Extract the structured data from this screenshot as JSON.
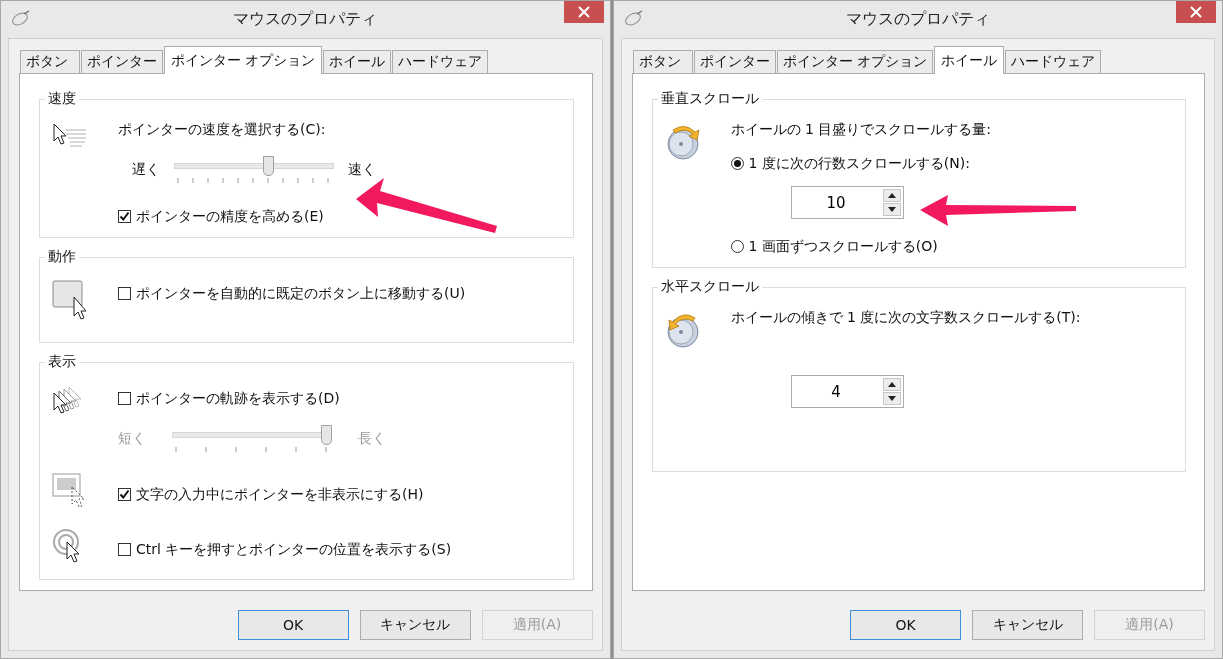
{
  "windows": [
    {
      "title": "マウスのプロパティ",
      "tabs": [
        {
          "label": "ボタン",
          "selected": false
        },
        {
          "label": "ポインター",
          "selected": false
        },
        {
          "label": "ポインター オプション",
          "selected": true
        },
        {
          "label": "ホイール",
          "selected": false
        },
        {
          "label": "ハードウェア",
          "selected": false
        }
      ],
      "groups": [
        {
          "title": "速度",
          "sections": [
            {
              "kind": "speed",
              "rows": [
                {
                  "kind": "label",
                  "text": "ポインターの速度を選択する(C):"
                },
                {
                  "kind": "slider",
                  "left": "遅く",
                  "right": "速く",
                  "level": 0.6,
                  "disabled": false
                },
                {
                  "kind": "checkbox",
                  "label": "ポインターの精度を高める(E)",
                  "checked": true
                }
              ]
            }
          ]
        },
        {
          "title": "動作",
          "sections": [
            {
              "kind": "snap",
              "rows": [
                {
                  "kind": "checkbox",
                  "label": "ポインターを自動的に既定のボタン上に移動する(U)",
                  "checked": false
                }
              ]
            }
          ]
        },
        {
          "title": "表示",
          "sections": [
            {
              "kind": "trails",
              "rows": [
                {
                  "kind": "checkbox",
                  "label": "ポインターの軌跡を表示する(D)",
                  "checked": false
                },
                {
                  "kind": "slider",
                  "left": "短く",
                  "right": "長く",
                  "level": 1,
                  "disabled": true
                }
              ]
            },
            {
              "kind": "hide",
              "rows": [
                {
                  "kind": "checkbox",
                  "label": "文字の入力中にポインターを非表示にする(H)",
                  "checked": true
                }
              ]
            },
            {
              "kind": "locate",
              "rows": [
                {
                  "kind": "checkbox",
                  "label": "Ctrl キーを押すとポインターの位置を表示する(S)",
                  "checked": false
                }
              ]
            }
          ]
        }
      ],
      "buttons": [
        {
          "label": "OK",
          "default": true,
          "disabled": false
        },
        {
          "label": "キャンセル",
          "default": false,
          "disabled": false
        },
        {
          "label": "適用(A)",
          "default": false,
          "disabled": true
        }
      ]
    },
    {
      "title": "マウスのプロパティ",
      "tabs": [
        {
          "label": "ボタン",
          "selected": false
        },
        {
          "label": "ポインター",
          "selected": false
        },
        {
          "label": "ポインター オプション",
          "selected": false
        },
        {
          "label": "ホイール",
          "selected": true
        },
        {
          "label": "ハードウェア",
          "selected": false
        }
      ],
      "groups": [
        {
          "title": "垂直スクロール",
          "sections": [
            {
              "kind": "vertical",
              "rows": [
                {
                  "kind": "label",
                  "text": "ホイールの 1 目盛りでスクロールする量:"
                },
                {
                  "kind": "radio",
                  "label": "1 度に次の行数スクロールする(N):",
                  "selected": true
                },
                {
                  "kind": "spinner",
                  "value": "10"
                },
                {
                  "kind": "radio",
                  "label": "1 画面ずつスクロールする(O)",
                  "selected": false
                }
              ]
            }
          ]
        },
        {
          "title": "水平スクロール",
          "sections": [
            {
              "kind": "horizontal",
              "rows": [
                {
                  "kind": "label",
                  "text": "ホイールの傾きで 1 度に次の文字数スクロールする(T):"
                },
                {
                  "kind": "spinner",
                  "value": "4"
                }
              ]
            }
          ]
        }
      ],
      "buttons": [
        {
          "label": "OK",
          "default": true,
          "disabled": false
        },
        {
          "label": "キャンセル",
          "default": false,
          "disabled": false
        },
        {
          "label": "適用(A)",
          "default": false,
          "disabled": true
        }
      ]
    }
  ]
}
